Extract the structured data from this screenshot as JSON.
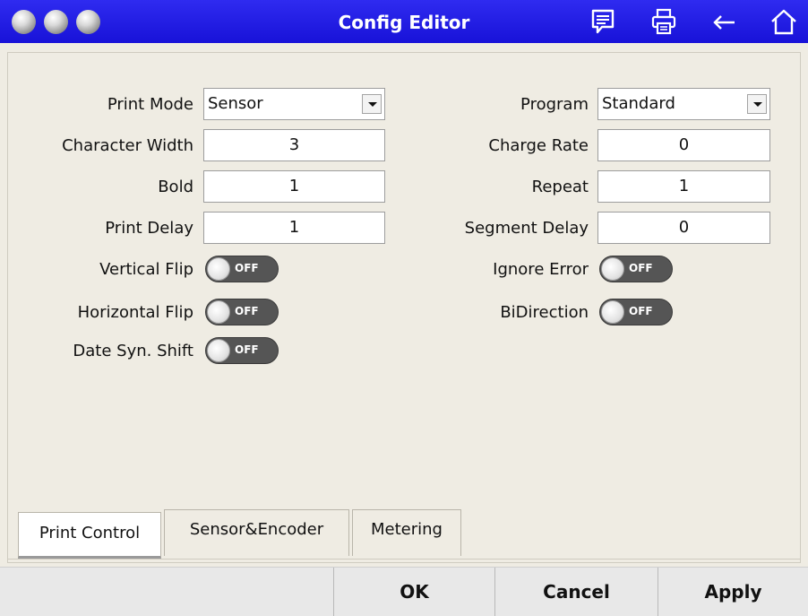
{
  "window": {
    "title": "Config Editor"
  },
  "toolbar_icons": [
    "comment-icon",
    "printer-icon",
    "back-arrow-icon",
    "home-icon"
  ],
  "form": {
    "left": {
      "print_mode": {
        "label": "Print Mode",
        "value": "Sensor"
      },
      "character_width": {
        "label": "Character Width",
        "value": "3"
      },
      "bold": {
        "label": "Bold",
        "value": "1"
      },
      "print_delay": {
        "label": "Print Delay",
        "value": "1"
      },
      "vertical_flip": {
        "label": "Vertical Flip",
        "state": "OFF"
      },
      "horizontal_flip": {
        "label": "Horizontal Flip",
        "state": "OFF"
      },
      "date_syn_shift": {
        "label": "Date Syn. Shift",
        "state": "OFF"
      }
    },
    "right": {
      "program": {
        "label": "Program",
        "value": "Standard"
      },
      "charge_rate": {
        "label": "Charge Rate",
        "value": "0"
      },
      "repeat": {
        "label": "Repeat",
        "value": "1"
      },
      "segment_delay": {
        "label": "Segment Delay",
        "value": "0"
      },
      "ignore_error": {
        "label": "Ignore Error",
        "state": "OFF"
      },
      "bidirection": {
        "label": "BiDirection",
        "state": "OFF"
      }
    }
  },
  "tabs": [
    {
      "label": "Print Control",
      "active": true
    },
    {
      "label": "Sensor&Encoder",
      "active": false
    },
    {
      "label": "Metering",
      "active": false
    }
  ],
  "buttons": {
    "ok": "OK",
    "cancel": "Cancel",
    "apply": "Apply"
  }
}
